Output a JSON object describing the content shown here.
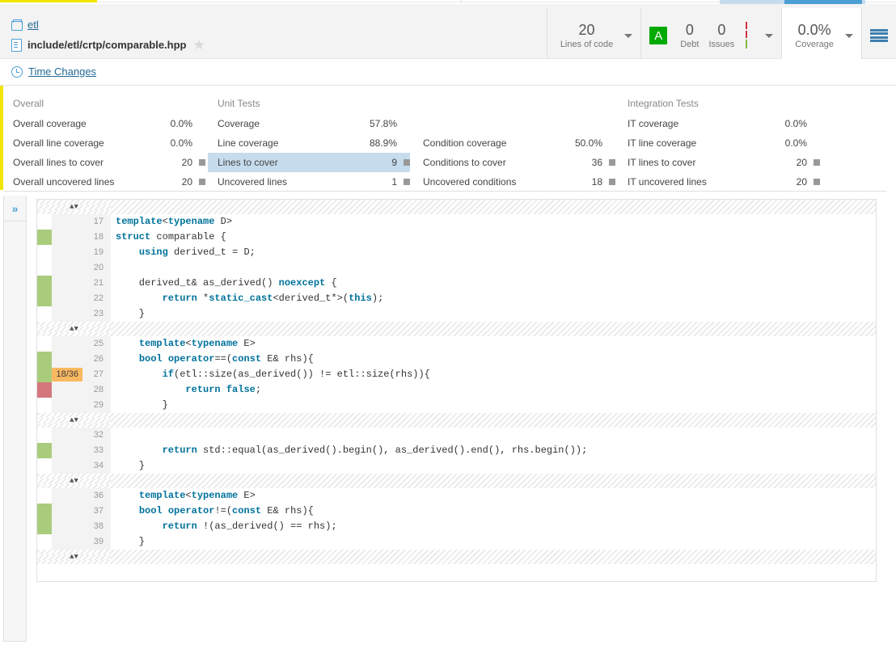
{
  "header": {
    "project_name": "etl",
    "file_path": "include/etl/crtp/comparable.hpp",
    "favorite_icon": "star-icon",
    "time_changes_label": "Time Changes",
    "metrics": [
      {
        "value": "20",
        "label": "Lines of code"
      },
      {
        "rating": "A",
        "value": "0",
        "label": "Debt",
        "value2": "0",
        "label2": "Issues"
      },
      {
        "value": "0.0%",
        "label": "Coverage"
      }
    ]
  },
  "measures": {
    "columns": [
      {
        "title": "Overall",
        "rows": [
          {
            "name": "Overall coverage",
            "value": "0.0%",
            "square": false,
            "highlight": false
          },
          {
            "name": "Overall line coverage",
            "value": "0.0%",
            "square": false,
            "highlight": false
          },
          {
            "name": "Overall lines to cover",
            "value": "20",
            "square": true,
            "highlight": false
          },
          {
            "name": "Overall uncovered lines",
            "value": "20",
            "square": true,
            "highlight": false
          }
        ]
      },
      {
        "title": "Unit Tests",
        "rows": [
          {
            "name": "Coverage",
            "value": "57.8%",
            "square": false,
            "highlight": false
          },
          {
            "name": "Line coverage",
            "value": "88.9%",
            "square": false,
            "highlight": false
          },
          {
            "name": "Lines to cover",
            "value": "9",
            "square": true,
            "highlight": true
          },
          {
            "name": "Uncovered lines",
            "value": "1",
            "square": true,
            "highlight": false
          }
        ]
      },
      {
        "title": "",
        "rows": [
          {
            "name": "",
            "value": "",
            "square": false,
            "highlight": false
          },
          {
            "name": "Condition coverage",
            "value": "50.0%",
            "square": false,
            "highlight": false
          },
          {
            "name": "Conditions to cover",
            "value": "36",
            "square": true,
            "highlight": false
          },
          {
            "name": "Uncovered conditions",
            "value": "18",
            "square": true,
            "highlight": false
          }
        ]
      },
      {
        "title": "Integration Tests",
        "rows": [
          {
            "name": "IT coverage",
            "value": "0.0%",
            "square": false,
            "highlight": false
          },
          {
            "name": "IT line coverage",
            "value": "0.0%",
            "square": false,
            "highlight": false
          },
          {
            "name": "IT lines to cover",
            "value": "20",
            "square": true,
            "highlight": false
          },
          {
            "name": "IT uncovered lines",
            "value": "20",
            "square": true,
            "highlight": false
          }
        ]
      }
    ]
  },
  "rail": {
    "expand_label": "»"
  },
  "code": {
    "separator_glyph": "▴▾",
    "lines": [
      {
        "type": "sep"
      },
      {
        "type": "line",
        "num": "17",
        "cov": "",
        "badge": "",
        "tokens": [
          {
            "t": "template",
            "c": "k"
          },
          {
            "t": "<",
            "c": "s"
          },
          {
            "t": "typename",
            "c": "k"
          },
          {
            "t": " D>",
            "c": "s"
          }
        ]
      },
      {
        "type": "line",
        "num": "18",
        "cov": "green",
        "badge": "",
        "tokens": [
          {
            "t": "struct",
            "c": "k"
          },
          {
            "t": " comparable {",
            "c": "s"
          }
        ]
      },
      {
        "type": "line",
        "num": "19",
        "cov": "",
        "badge": "",
        "tokens": [
          {
            "t": "    ",
            "c": "s"
          },
          {
            "t": "using",
            "c": "k"
          },
          {
            "t": " derived_t = D;",
            "c": "s"
          }
        ]
      },
      {
        "type": "line",
        "num": "20",
        "cov": "",
        "badge": "",
        "tokens": [
          {
            "t": "",
            "c": "s"
          }
        ]
      },
      {
        "type": "line",
        "num": "21",
        "cov": "green",
        "badge": "",
        "tokens": [
          {
            "t": "    derived_t& as_derived() ",
            "c": "s"
          },
          {
            "t": "noexcept",
            "c": "k"
          },
          {
            "t": " {",
            "c": "s"
          }
        ]
      },
      {
        "type": "line",
        "num": "22",
        "cov": "green",
        "badge": "",
        "tokens": [
          {
            "t": "        ",
            "c": "s"
          },
          {
            "t": "return",
            "c": "k"
          },
          {
            "t": " *",
            "c": "s"
          },
          {
            "t": "static_cast",
            "c": "k"
          },
          {
            "t": "<derived_t*>(",
            "c": "s"
          },
          {
            "t": "this",
            "c": "k"
          },
          {
            "t": ");",
            "c": "s"
          }
        ]
      },
      {
        "type": "line",
        "num": "23",
        "cov": "",
        "badge": "",
        "tokens": [
          {
            "t": "    }",
            "c": "s"
          }
        ]
      },
      {
        "type": "sep"
      },
      {
        "type": "line",
        "num": "25",
        "cov": "",
        "badge": "",
        "tokens": [
          {
            "t": "    ",
            "c": "s"
          },
          {
            "t": "template",
            "c": "k"
          },
          {
            "t": "<",
            "c": "s"
          },
          {
            "t": "typename",
            "c": "k"
          },
          {
            "t": " E>",
            "c": "s"
          }
        ]
      },
      {
        "type": "line",
        "num": "26",
        "cov": "green",
        "badge": "",
        "tokens": [
          {
            "t": "    ",
            "c": "s"
          },
          {
            "t": "bool",
            "c": "k"
          },
          {
            "t": " ",
            "c": "s"
          },
          {
            "t": "operator",
            "c": "k"
          },
          {
            "t": "==(",
            "c": "s"
          },
          {
            "t": "const",
            "c": "k"
          },
          {
            "t": " E& rhs){",
            "c": "s"
          }
        ]
      },
      {
        "type": "line",
        "num": "27",
        "cov": "green",
        "badge": "18/36",
        "tokens": [
          {
            "t": "        ",
            "c": "s"
          },
          {
            "t": "if",
            "c": "k"
          },
          {
            "t": "(etl::size(as_derived()) != etl::size(rhs)){",
            "c": "s"
          }
        ]
      },
      {
        "type": "line",
        "num": "28",
        "cov": "red",
        "badge": "",
        "tokens": [
          {
            "t": "            ",
            "c": "s"
          },
          {
            "t": "return",
            "c": "k"
          },
          {
            "t": " ",
            "c": "s"
          },
          {
            "t": "false",
            "c": "k"
          },
          {
            "t": ";",
            "c": "s"
          }
        ]
      },
      {
        "type": "line",
        "num": "29",
        "cov": "",
        "badge": "",
        "tokens": [
          {
            "t": "        }",
            "c": "s"
          }
        ]
      },
      {
        "type": "sep"
      },
      {
        "type": "line",
        "num": "32",
        "cov": "",
        "badge": "",
        "tokens": [
          {
            "t": "",
            "c": "s"
          }
        ]
      },
      {
        "type": "line",
        "num": "33",
        "cov": "green",
        "badge": "",
        "tokens": [
          {
            "t": "        ",
            "c": "s"
          },
          {
            "t": "return",
            "c": "k"
          },
          {
            "t": " std::equal(as_derived().begin(), as_derived().end(), rhs.begin());",
            "c": "s"
          }
        ]
      },
      {
        "type": "line",
        "num": "34",
        "cov": "",
        "badge": "",
        "tokens": [
          {
            "t": "    }",
            "c": "s"
          }
        ]
      },
      {
        "type": "sep"
      },
      {
        "type": "line",
        "num": "36",
        "cov": "",
        "badge": "",
        "tokens": [
          {
            "t": "    ",
            "c": "s"
          },
          {
            "t": "template",
            "c": "k"
          },
          {
            "t": "<",
            "c": "s"
          },
          {
            "t": "typename",
            "c": "k"
          },
          {
            "t": " E>",
            "c": "s"
          }
        ]
      },
      {
        "type": "line",
        "num": "37",
        "cov": "green",
        "badge": "",
        "tokens": [
          {
            "t": "    ",
            "c": "s"
          },
          {
            "t": "bool",
            "c": "k"
          },
          {
            "t": " ",
            "c": "s"
          },
          {
            "t": "operator",
            "c": "k"
          },
          {
            "t": "!=(",
            "c": "s"
          },
          {
            "t": "const",
            "c": "k"
          },
          {
            "t": " E& rhs){",
            "c": "s"
          }
        ]
      },
      {
        "type": "line",
        "num": "38",
        "cov": "green",
        "badge": "",
        "tokens": [
          {
            "t": "        ",
            "c": "s"
          },
          {
            "t": "return",
            "c": "k"
          },
          {
            "t": " !(as_derived() == rhs);",
            "c": "s"
          }
        ]
      },
      {
        "type": "line",
        "num": "39",
        "cov": "",
        "badge": "",
        "tokens": [
          {
            "t": "    }",
            "c": "s"
          }
        ]
      },
      {
        "type": "sep"
      }
    ]
  },
  "colors": {
    "accent_blue": "#4b9fd5",
    "link_blue": "#236a97",
    "covered_green": "#a9cc7c",
    "uncovered_red": "#d4777d",
    "condition_badge_orange": "#f9b960",
    "rating_a_green": "#00aa00",
    "highlight_blue": "#c6dced",
    "yellow_accent": "#f2e600"
  }
}
